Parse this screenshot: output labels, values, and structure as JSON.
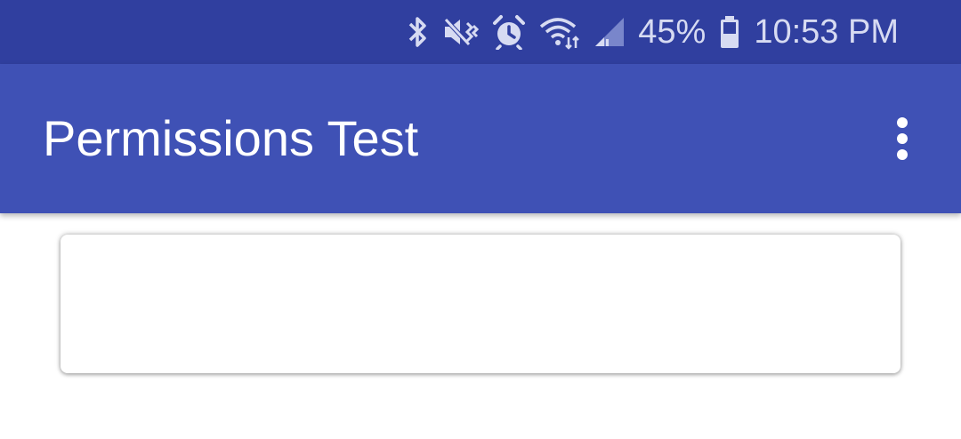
{
  "status_bar": {
    "icons": [
      "bluetooth-icon",
      "vibrate-mute-icon",
      "alarm-icon",
      "wifi-icon",
      "cell-signal-icon",
      "battery-icon"
    ],
    "battery_percent": "45%",
    "time": "10:53 PM",
    "background_color": "#303F9F"
  },
  "app_bar": {
    "title": "Permissions Test",
    "menu_icon": "more-vert-icon",
    "background_color": "#3F51B5"
  },
  "content": {
    "card": {}
  }
}
